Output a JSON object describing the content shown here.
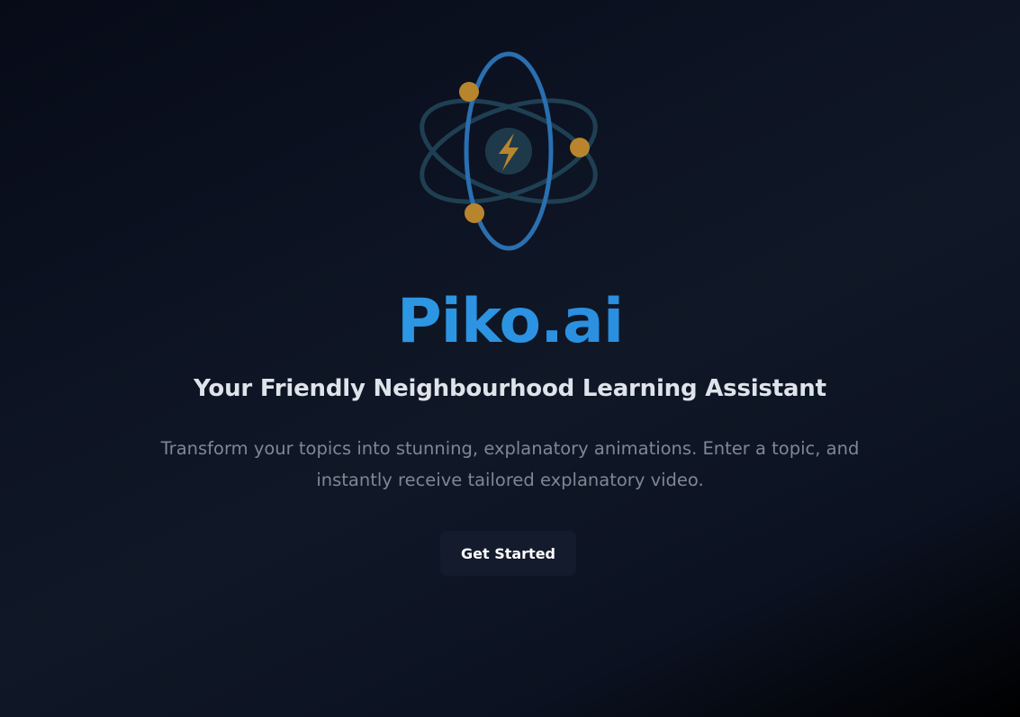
{
  "hero": {
    "logo_icon": "atom-lightning-icon",
    "brand": "Piko.ai",
    "tagline": "Your Friendly Neighbourhood Learning Assistant",
    "description": "Transform your topics into stunning, explanatory animations. Enter a topic, and instantly receive tailored explanatory video.",
    "cta_label": "Get Started"
  },
  "colors": {
    "background_dark": "#070b18",
    "orbit_blue": "#2a6fb0",
    "orbit_teal": "#1f3f52",
    "electron_gold": "#b8852e",
    "brand_blue": "#2b8fe0",
    "button_bg": "#131b2c"
  }
}
